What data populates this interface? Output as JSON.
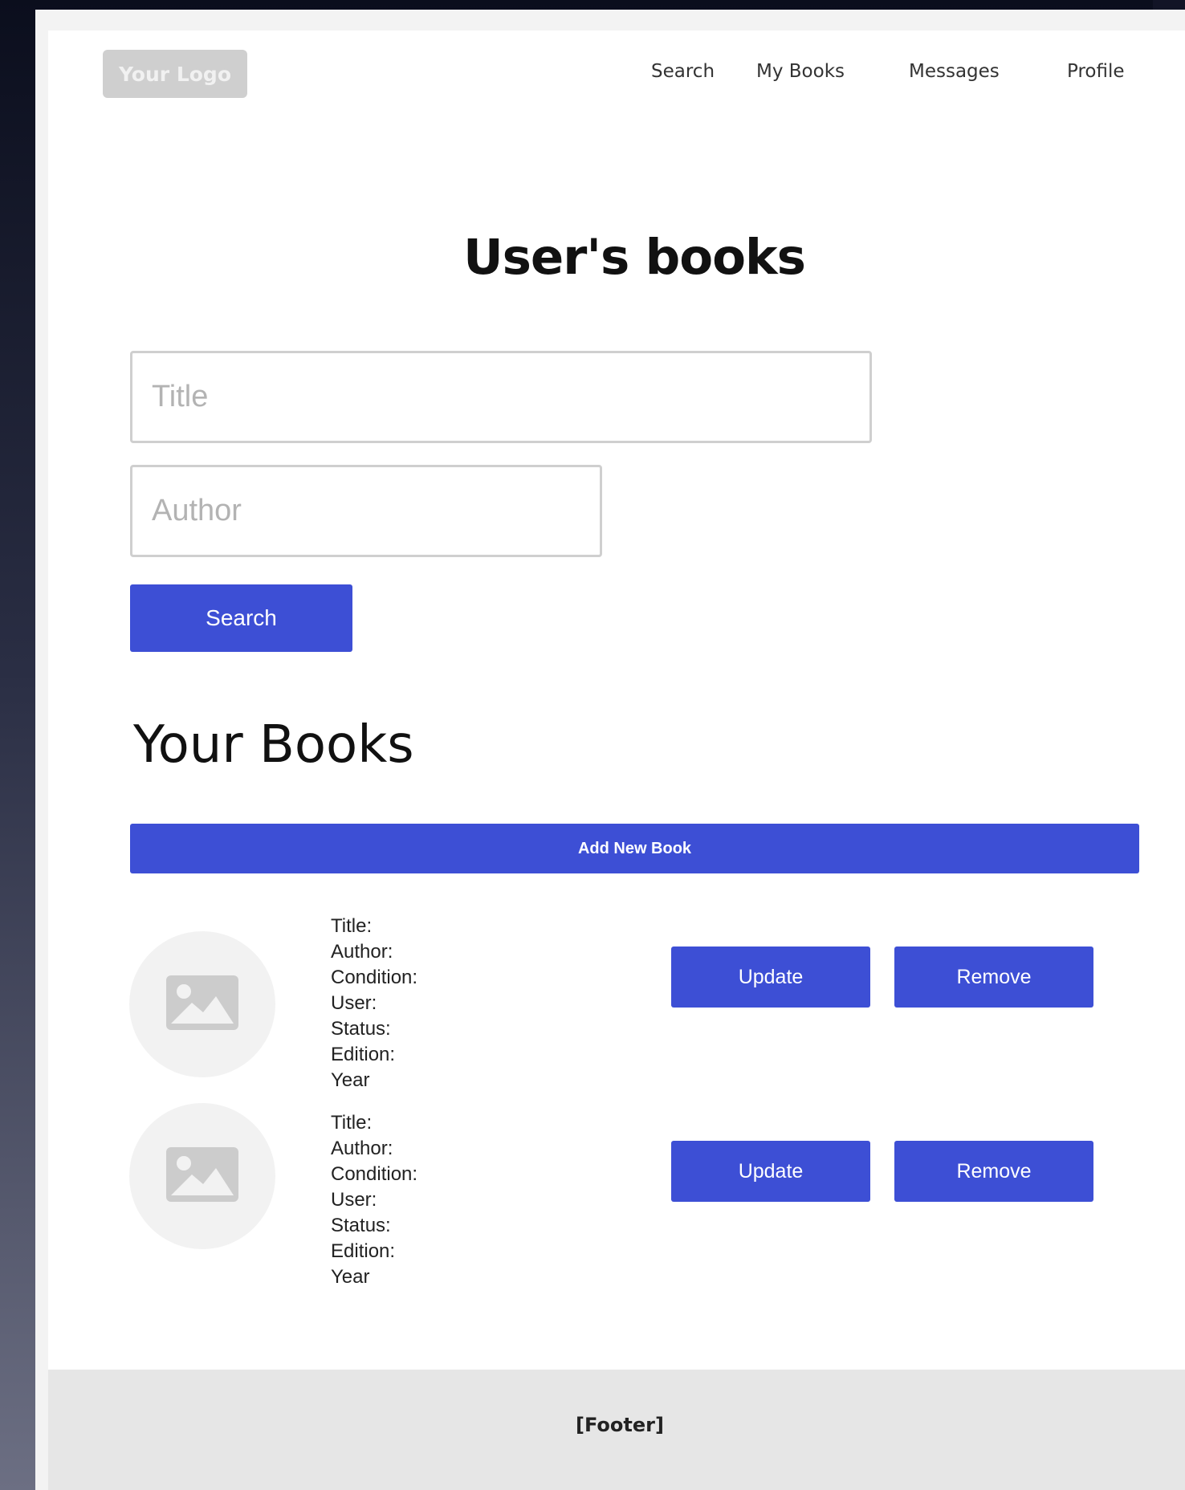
{
  "header": {
    "logo": "Your Logo",
    "nav": [
      {
        "label": "Search"
      },
      {
        "label": "My Books"
      },
      {
        "label": "Messages"
      },
      {
        "label": "Profile"
      }
    ]
  },
  "page_title": "User's books",
  "search_form": {
    "title_placeholder": "Title",
    "author_placeholder": "Author",
    "search_button": "Search"
  },
  "your_books": {
    "heading": "Your Books",
    "add_button": "Add New Book",
    "books": [
      {
        "fields": [
          "Title:",
          "Author:",
          "Condition:",
          "User:",
          "Status:",
          "Edition:",
          "Year"
        ],
        "update_label": "Update",
        "remove_label": "Remove"
      },
      {
        "fields": [
          "Title:",
          "Author:",
          "Condition:",
          "User:",
          "Status:",
          "Edition:",
          "Year"
        ],
        "update_label": "Update",
        "remove_label": "Remove"
      }
    ]
  },
  "footer": {
    "label": "[Footer]"
  },
  "colors": {
    "accent": "#3d4fd5",
    "logo_bg": "#cfcfcf",
    "footer_bg": "#e6e6e6",
    "image_placeholder": "#cccccc"
  },
  "icons": {
    "book_image": "image-placeholder-icon"
  }
}
